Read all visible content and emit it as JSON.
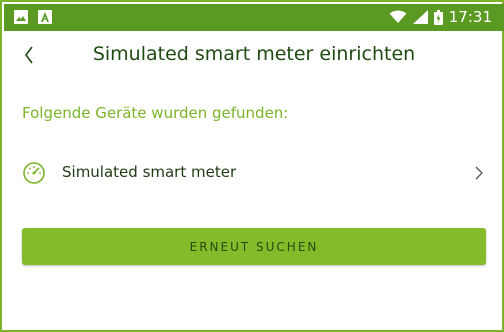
{
  "status_bar": {
    "time": "17:31",
    "left_icons": [
      "image-icon",
      "app-a-icon"
    ],
    "right_icons": [
      "wifi-icon",
      "signal-icon",
      "battery-icon"
    ],
    "background": "#5a9a22"
  },
  "header": {
    "title": "Simulated smart meter einrichten",
    "back_icon": "chevron-left-icon"
  },
  "section": {
    "heading": "Folgende Geräte wurden gefunden:"
  },
  "devices": [
    {
      "label": "Simulated smart meter",
      "icon": "gauge-icon",
      "chevron": "chevron-right-icon"
    }
  ],
  "actions": {
    "search_again_label": "ERNEUT SUCHEN"
  },
  "colors": {
    "accent": "#7bb42a",
    "button": "#84bb2a",
    "title_text": "#1f4a12"
  }
}
